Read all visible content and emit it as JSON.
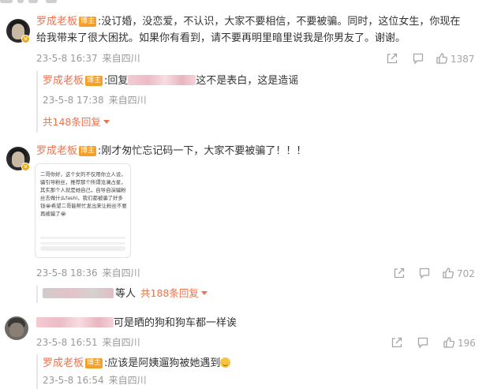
{
  "comments": [
    {
      "author": "罗成老板",
      "badge": "博主",
      "text": ":没订婚，没恋爱，不认识，大家不要相信，不要被骗。同时，这位女生，你现在",
      "text2": "给我带来了很大困扰。如果你有看到，请不要再明里暗里说我是你男友了。谢谢。",
      "time": "23-5-8 16:37",
      "location": "来自四川",
      "likes": "1387",
      "reply": {
        "author": "罗成老板",
        "badge": "博主",
        "prefix": ":回复",
        "text": "这不是表白，这是造谣",
        "time": "23-5-8 17:38",
        "location": "来自四川"
      },
      "more_replies": "共148条回复"
    },
    {
      "author": "罗成老板",
      "badge": "博主",
      "text": ":刚才匆忙忘记码一下，大家不要被骗了！！！",
      "image_text": "二哥你好，这个女的不仅用你立人设，骗引导粉丝，推荐那个所谓沧澜占星，其实那个人就是她自己，自导自演骗粉丝去做什么fashi，我们都被骗了好多钱😭希望二哥能帮忙发出来让粉丝不要再被骗了😭",
      "time": "23-5-8 18:36",
      "location": "来自四川",
      "likes": "702",
      "reply_summary_suffix": "等人",
      "more_replies": "共188条回复"
    },
    {
      "text": "可是晒的狗和狗车都一样诶",
      "time": "23-5-8 16:51",
      "location": "来自四川",
      "likes": "196",
      "reply": {
        "author": "罗成老板",
        "badge": "博主",
        "text": ":应该是阿姨遛狗被她遇到",
        "time": "23-5-8 16:54",
        "location": "来自四川"
      }
    }
  ],
  "icons": [
    "share-icon",
    "comment-icon",
    "like-icon",
    "avatar-verified-badge"
  ],
  "colors": {
    "name": "#eb7350",
    "badge": "#f3a02a",
    "meta": "#999999",
    "text": "#333333"
  }
}
